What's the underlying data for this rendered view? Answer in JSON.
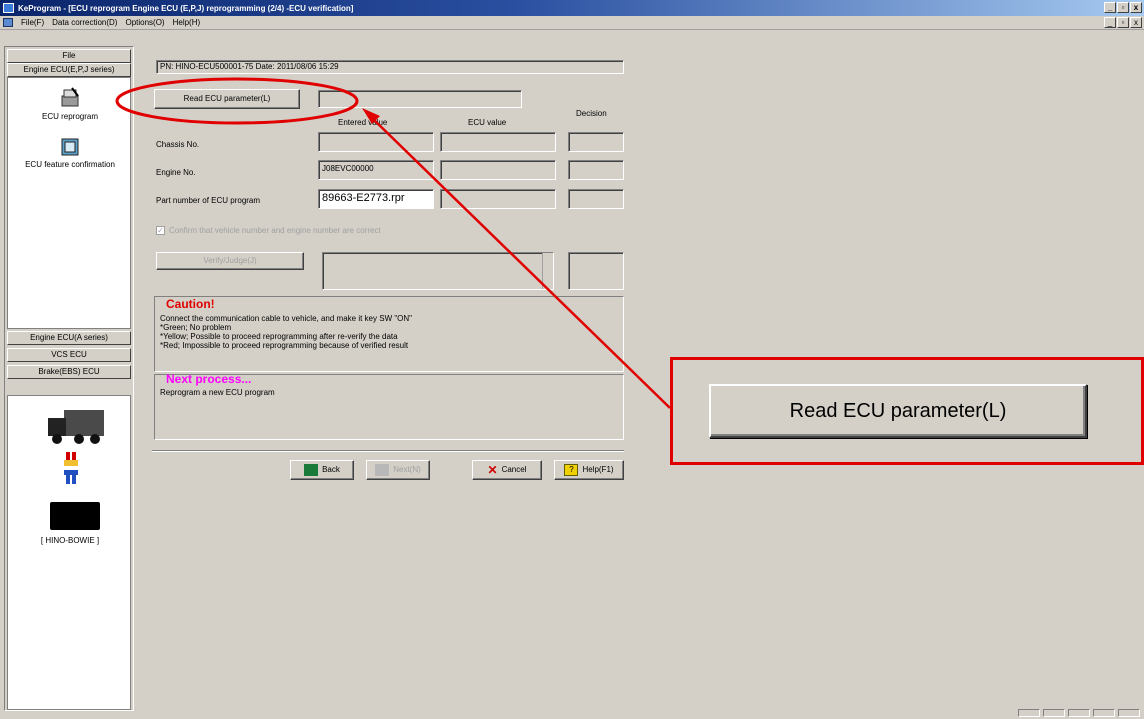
{
  "window": {
    "title": "KeProgram - [ECU reprogram Engine ECU (E,P,J) reprogramming (2/4) -ECU verification]",
    "controls": {
      "minimize": "_",
      "restore": "▫",
      "close": "x"
    }
  },
  "menu": {
    "items": [
      "File(F)",
      "Data correction(D)",
      "Options(O)",
      "Help(H)"
    ]
  },
  "sidebar": {
    "file_button": "File",
    "group_top": "Engine ECU(E,P,J series)",
    "nav": [
      {
        "label": "ECU reprogram",
        "icon": "ecu-reprogram-icon"
      },
      {
        "label": "ECU feature confirmation",
        "icon": "ecu-feature-icon"
      }
    ],
    "groups_bottom": [
      "Engine ECU(A series)",
      "VCS ECU",
      "Brake(EBS) ECU"
    ],
    "device_label": "[ HINO-BOWIE ]"
  },
  "main": {
    "info_line": "PN: HINO-ECU500001-75  Date: 2011/08/06 15:29",
    "read_button": "Read ECU parameter(L)",
    "read_status": "",
    "headers": {
      "entered": "Entered value",
      "ecu": "ECU value",
      "decision": "Decision"
    },
    "rows": [
      {
        "label": "Chassis No.",
        "entered": "",
        "ecu": "",
        "decision": ""
      },
      {
        "label": "Engine No.",
        "entered": "J08EVC00000",
        "ecu": "",
        "decision": ""
      },
      {
        "label": "Part number of ECU program",
        "entered": "89663-E2773.rpr",
        "ecu": "",
        "decision": ""
      }
    ],
    "confirm_checkbox": "Confirm that vehicle number and engine number are correct",
    "verify_button": "Verify/Judge(J)",
    "caution_title": "Caution!",
    "caution_lines": [
      "Connect the communication cable to vehicle, and make it key SW \"ON\"",
      "*Green; No problem",
      "*Yellow; Possible to proceed reprogramming after re-verify the data",
      "*Red; Impossible to proceed reprogramming because of verified result"
    ],
    "next_title": "Next process...",
    "next_text": "Reprogram a new ECU program",
    "buttons": {
      "back": "Back",
      "next": "Next(N)",
      "cancel": "Cancel",
      "help": "Help(F1)"
    }
  },
  "callout": {
    "label": "Read ECU parameter(L)"
  },
  "colors": {
    "annotation": "#e00000",
    "caution": "#e00000",
    "next_process": "#ff00ff"
  }
}
